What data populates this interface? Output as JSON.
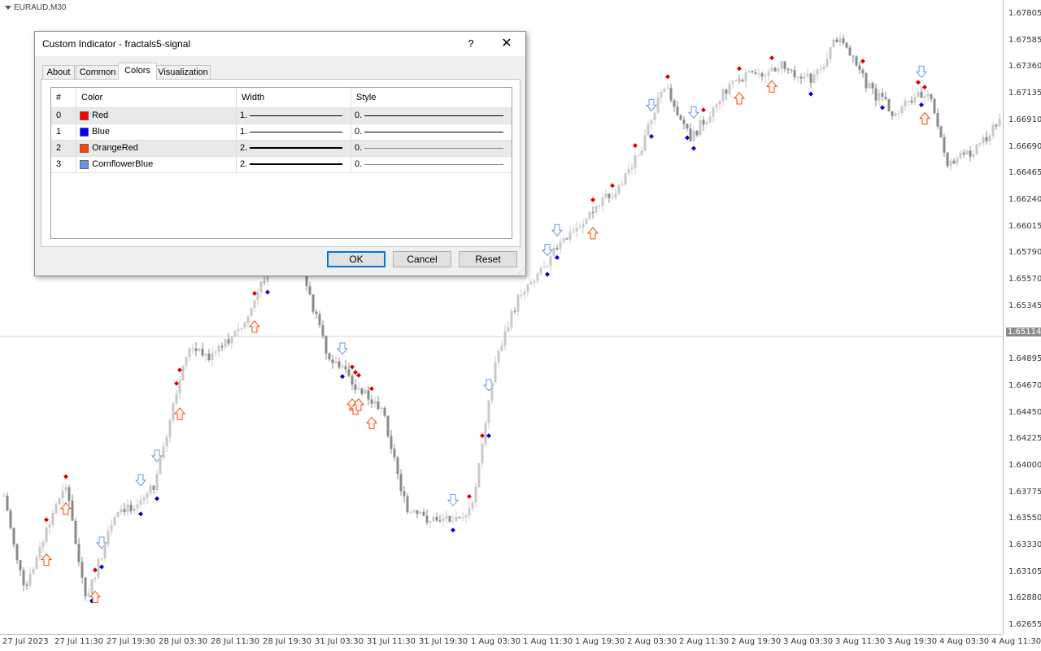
{
  "chart": {
    "symbol_label": "EURAUD,M30",
    "price_ticks": [
      "1.67805",
      "1.67585",
      "1.67360",
      "1.67135",
      "1.66910",
      "1.66690",
      "1.66465",
      "1.66240",
      "1.66015",
      "1.65790",
      "1.65570",
      "1.65345",
      "1.65114",
      "1.64895",
      "1.64670",
      "1.64450",
      "1.64225",
      "1.64000",
      "1.63775",
      "1.63550",
      "1.63330",
      "1.63105",
      "1.62880",
      "1.62655"
    ],
    "current_price": "1.65114",
    "time_ticks": [
      "27 Jul 2023",
      "27 Jul 11:30",
      "27 Jul 19:30",
      "28 Jul 03:30",
      "28 Jul 11:30",
      "28 Jul 19:30",
      "31 Jul 03:30",
      "31 Jul 11:30",
      "31 Jul 19:30",
      "1 Aug 03:30",
      "1 Aug 11:30",
      "1 Aug 19:30",
      "2 Aug 03:30",
      "2 Aug 11:30",
      "2 Aug 19:30",
      "3 Aug 03:30",
      "3 Aug 11:30",
      "3 Aug 19:30",
      "4 Aug 03:30",
      "4 Aug 11:30"
    ],
    "colors": {
      "bull": "#c8c8c8",
      "bear": "#8a8a8a",
      "fractal_up": "#e00000",
      "fractal_down": "#0000cc",
      "arrow_up": "#ff4500",
      "arrow_down": "#6495ed"
    }
  },
  "dialog": {
    "title": "Custom Indicator - fractals5-signal",
    "help_label": "?",
    "close_label": "✕",
    "tabs": [
      {
        "label": "About"
      },
      {
        "label": "Common"
      },
      {
        "label": "Colors"
      },
      {
        "label": "Visualization"
      }
    ],
    "columns": [
      "#",
      "Color",
      "Width",
      "Style"
    ],
    "rows": [
      {
        "index": "0",
        "color_name": "Red",
        "swatch": "#ff0000",
        "width": "1.",
        "style": "0."
      },
      {
        "index": "1",
        "color_name": "Blue",
        "swatch": "#0000ff",
        "width": "1.",
        "style": "0."
      },
      {
        "index": "2",
        "color_name": "OrangeRed",
        "swatch": "#ff4500",
        "width": "2.",
        "style": "0."
      },
      {
        "index": "3",
        "color_name": "CornflowerBlue",
        "swatch": "#6495ed",
        "width": "2.",
        "style": "0."
      }
    ],
    "buttons": {
      "ok": "OK",
      "cancel": "Cancel",
      "reset": "Reset"
    }
  }
}
